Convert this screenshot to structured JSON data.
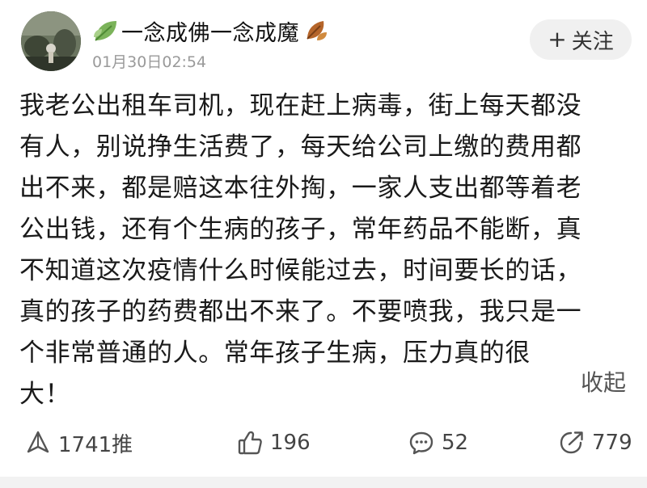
{
  "post": {
    "author": {
      "name": "一念成佛一念成魔",
      "avatar_icon": "avatar-photo-icon",
      "name_prefix_icon": "leaf-icon",
      "name_suffix_icon": "autumn-leaf-icon"
    },
    "timestamp": "01月30日02:54",
    "follow_button": {
      "icon": "+",
      "label": "关注"
    },
    "body_lines": [
      "我老公出租车司机，现在赶上病毒，街上每天都没",
      "有人，别说挣生活费了，每天给公司上缴的费用都",
      "出不来，都是赔这本往外掏，一家人支出都等着老",
      "公出钱，还有个生病的孩子，常年药品不能断，真",
      "不知道这次疫情什么时候能过去，时间要长的话，",
      "真的孩子的药费都出不来了。不要喷我，我只是一",
      "个非常普通的人。常年孩子生病，压力真的很",
      "大！"
    ],
    "collapse_label": "收起",
    "actions": {
      "push": {
        "icon": "push-icon",
        "count": "1741推"
      },
      "like": {
        "icon": "thumbs-up-icon",
        "count": "196"
      },
      "comment": {
        "icon": "comment-icon",
        "count": "52"
      },
      "share": {
        "icon": "share-icon",
        "count": "779"
      }
    }
  },
  "colors": {
    "text": "#1a1a1a",
    "muted": "#9a9a9a",
    "follow_bg": "#f0f0f0",
    "icon": "#555555"
  }
}
